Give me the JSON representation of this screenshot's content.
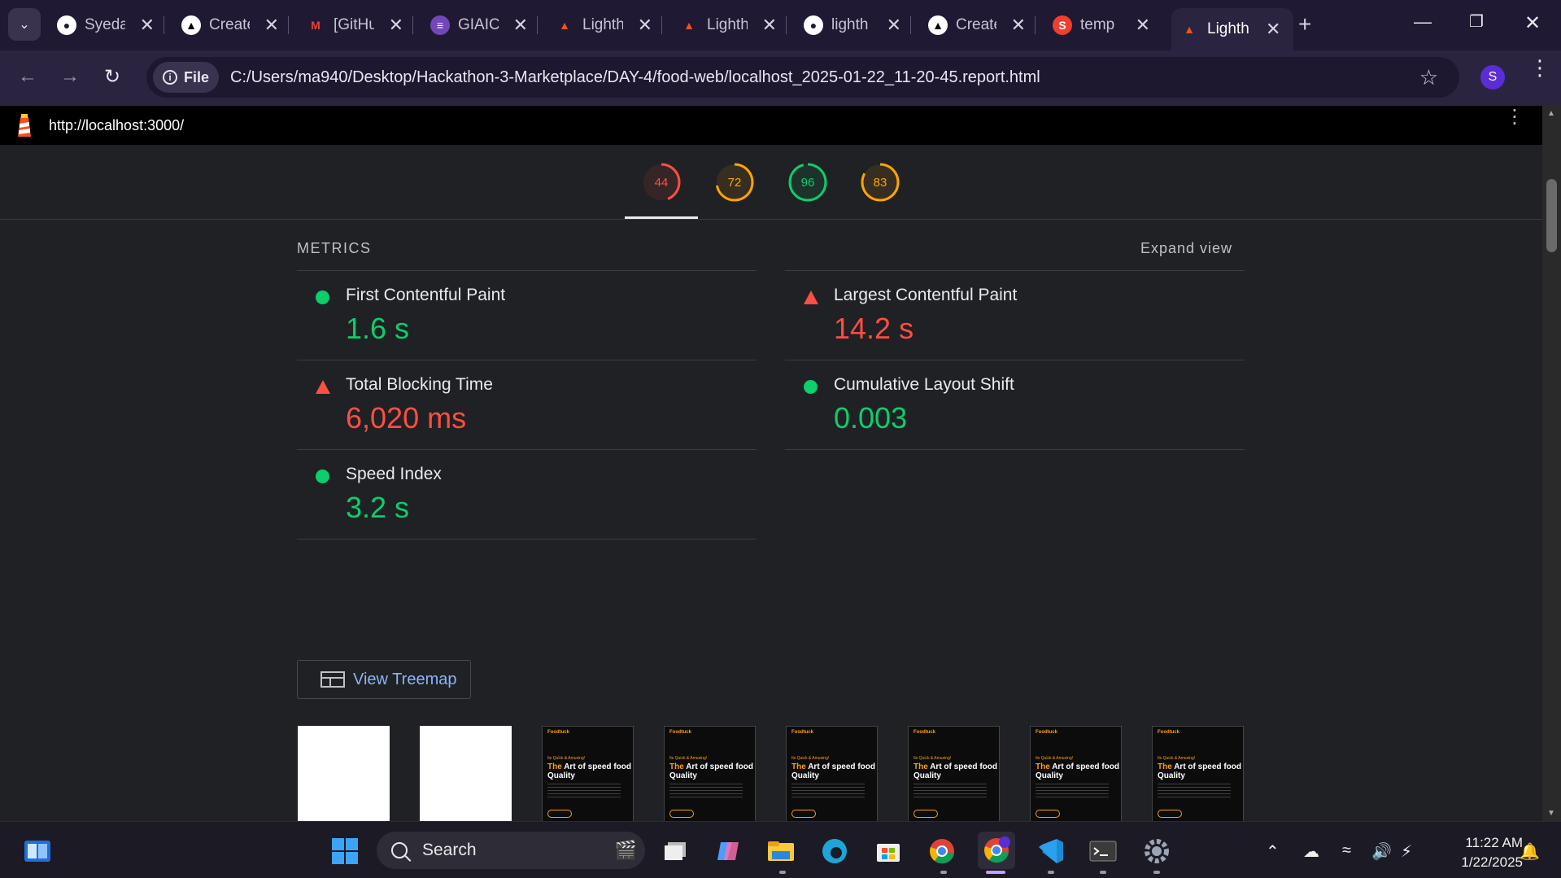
{
  "browser": {
    "tabs": [
      {
        "title": "Syeda",
        "icon": "github-icon",
        "active": false
      },
      {
        "title": "Create",
        "icon": "vercel-icon",
        "active": false
      },
      {
        "title": "[GitHu",
        "icon": "gmail-icon",
        "active": false
      },
      {
        "title": "GIAIC",
        "icon": "forms-icon",
        "active": false
      },
      {
        "title": "Lighth",
        "icon": "lighthouse-icon",
        "active": false
      },
      {
        "title": "Lighth",
        "icon": "lighthouse-icon",
        "active": false
      },
      {
        "title": "lighth",
        "icon": "github-icon",
        "active": false
      },
      {
        "title": "Create",
        "icon": "vercel-icon",
        "active": false
      },
      {
        "title": "temp",
        "icon": "sanity-icon",
        "active": false
      },
      {
        "title": "Lighth",
        "icon": "lighthouse-icon",
        "active": true
      }
    ],
    "file_chip": "File",
    "url": "C:/Users/ma940/Desktop/Hackathon-3-Marketplace/DAY-4/food-web/localhost_2025-01-22_11-20-45.report.html",
    "profile_initial": "S"
  },
  "report": {
    "page_url": "http://localhost:3000/",
    "scores": [
      {
        "value": "44",
        "color": "#ff4e42",
        "fraction": 0.44
      },
      {
        "value": "72",
        "color": "#ffa400",
        "fraction": 0.72
      },
      {
        "value": "96",
        "color": "#0cce6b",
        "fraction": 0.96
      },
      {
        "value": "83",
        "color": "#ffa400",
        "fraction": 0.83
      }
    ],
    "metrics_title": "METRICS",
    "expand_label": "Expand view",
    "metrics_left": [
      {
        "label": "First Contentful Paint",
        "value": "1.6 s",
        "status": "pass",
        "color": "#0cce6b"
      },
      {
        "label": "Total Blocking Time",
        "value": "6,020 ms",
        "status": "fail",
        "color": "#ff4e42"
      },
      {
        "label": "Speed Index",
        "value": "3.2 s",
        "status": "pass",
        "color": "#0cce6b"
      }
    ],
    "metrics_right": [
      {
        "label": "Largest Contentful Paint",
        "value": "14.2 s",
        "status": "fail",
        "color": "#ff4e42"
      },
      {
        "label": "Cumulative Layout Shift",
        "value": "0.003",
        "status": "pass",
        "color": "#0cce6b"
      }
    ],
    "treemap_label": "View Treemap",
    "filmstrip": {
      "brand": "Foodtuck",
      "tagline": "Its Quick & Amusing!",
      "heading_accent": "The",
      "heading_rest": "Art of speed food Quality",
      "frames": [
        "blank",
        "blank",
        "shot",
        "shot",
        "shot",
        "shot",
        "shot",
        "shot"
      ]
    }
  },
  "taskbar": {
    "search_label": "Search",
    "time": "11:22 AM",
    "date": "1/22/2025"
  }
}
